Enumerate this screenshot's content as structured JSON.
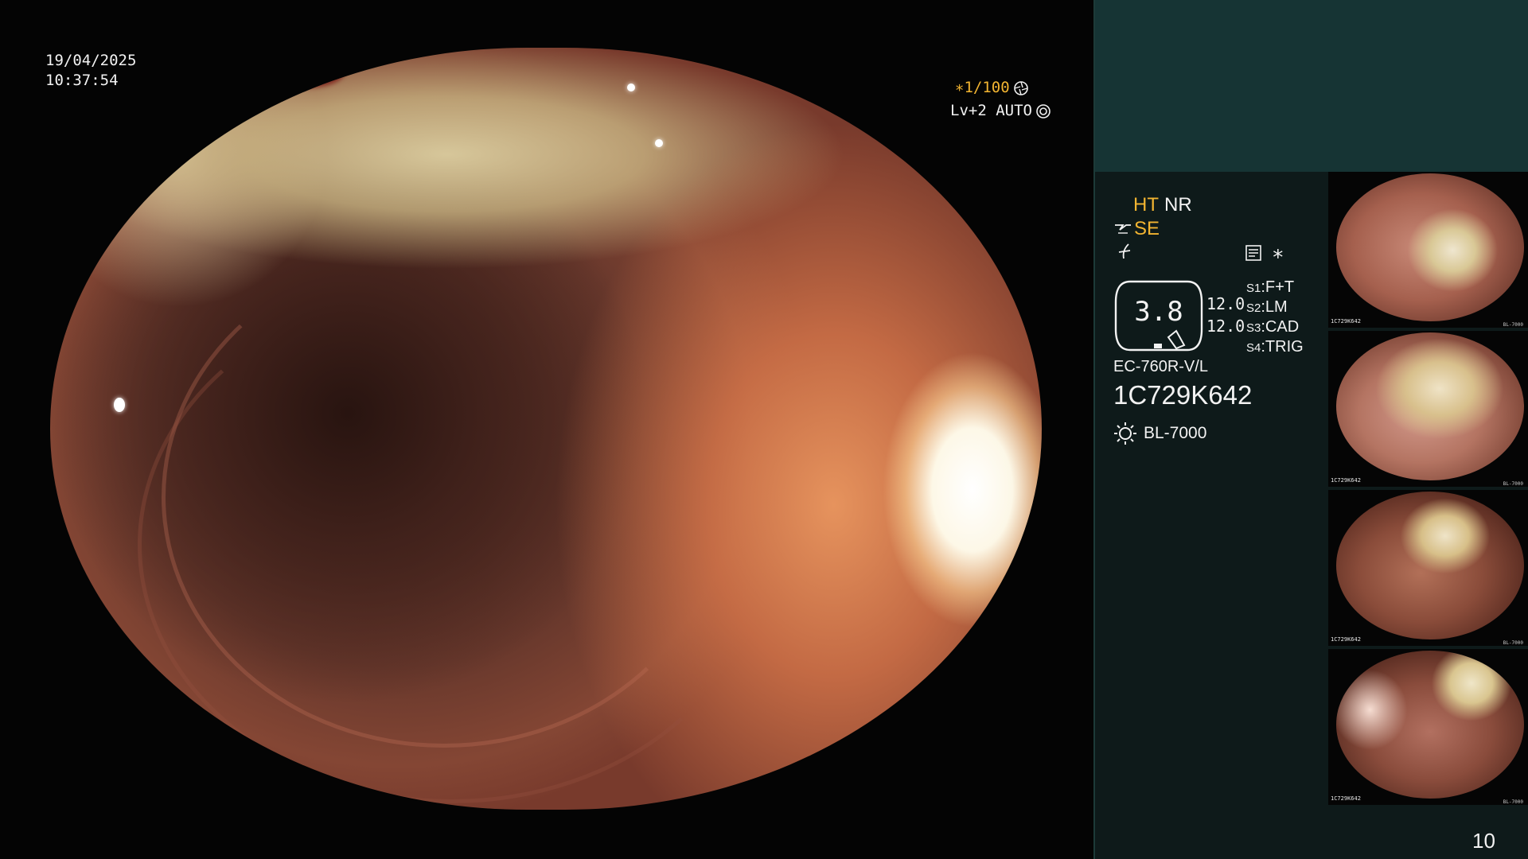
{
  "overlay": {
    "date": "19/04/2025",
    "time": "10:37:54",
    "shutter": "∗1/100",
    "level": "Lv+2 AUTO"
  },
  "panel": {
    "ht_label": "HT",
    "nr_label": "NR",
    "se_label": "SE",
    "star_label": "∗",
    "gauge_value": "3.8",
    "gain_1": "12.0",
    "gain_2": "12.0",
    "switches": [
      {
        "key": "S1",
        "value": "F+T"
      },
      {
        "key": "S2",
        "value": "LM"
      },
      {
        "key": "S3",
        "value": "CAD"
      },
      {
        "key": "S4",
        "value": "TRIG"
      }
    ],
    "scope_model": "EC-760R-V/L",
    "scope_serial": "1C729K642",
    "light_source": "BL-7000"
  },
  "thumbnails": [
    {
      "caption": "1C729K642",
      "tag": "BL-7000"
    },
    {
      "caption": "1C729K642",
      "tag": "BL-7000"
    },
    {
      "caption": "1C729K642",
      "tag": "BL-7000"
    },
    {
      "caption": "1C729K642",
      "tag": "BL-7000"
    }
  ],
  "page_number": "10",
  "colors": {
    "accent": "#f2b431",
    "panel_top": "#163434",
    "panel": "#0e1a1a"
  }
}
